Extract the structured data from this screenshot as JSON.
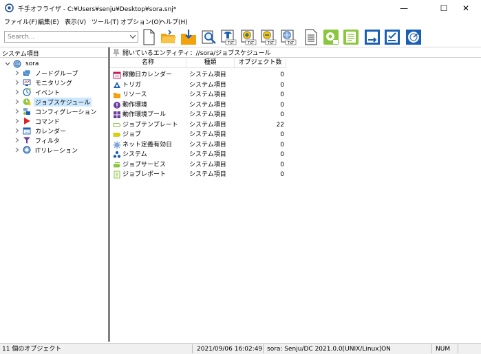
{
  "window": {
    "title": "千手オフライザ - C:¥Users¥senju¥Desktop¥sora.snj*",
    "minimize_glyph": "—",
    "maximize_glyph": "☐",
    "close_glyph": "✕"
  },
  "menu": {
    "items": [
      "ファイル(F)",
      "編集(E)",
      "表示(V)",
      "ツール(T)",
      "オプション(O)",
      "ヘルプ(H)"
    ]
  },
  "toolbar": {
    "search_placeholder": "Search...",
    "txt_label": "TXT"
  },
  "tree": {
    "header": "システム項目",
    "root_label": "sora",
    "items": [
      {
        "label": "ノードグループ",
        "icon": "node-group-icon"
      },
      {
        "label": "モニタリング",
        "icon": "monitoring-icon"
      },
      {
        "label": "イベント",
        "icon": "event-icon"
      },
      {
        "label": "ジョブスケジュール",
        "icon": "job-schedule-icon",
        "selected": true
      },
      {
        "label": "コンフィグレーション",
        "icon": "configuration-icon"
      },
      {
        "label": "コマンド",
        "icon": "command-icon"
      },
      {
        "label": "カレンダー",
        "icon": "calendar-icon"
      },
      {
        "label": "フィルタ",
        "icon": "filter-icon"
      },
      {
        "label": "ITリレーション",
        "icon": "it-relation-icon"
      }
    ]
  },
  "entity": {
    "label": "開いているエンティティ：//sora/ジョブスケジュール"
  },
  "table": {
    "columns": [
      "名称",
      "種類",
      "オブジェクト数"
    ],
    "rows": [
      {
        "name": "稼働日カレンダー",
        "type": "システム項目",
        "count": "0",
        "icon": "working-calendar-icon"
      },
      {
        "name": "トリガ",
        "type": "システム項目",
        "count": "0",
        "icon": "trigger-icon"
      },
      {
        "name": "リソース",
        "type": "システム項目",
        "count": "0",
        "icon": "resource-icon"
      },
      {
        "name": "動作環境",
        "type": "システム項目",
        "count": "0",
        "icon": "environment-icon"
      },
      {
        "name": "動作環境プール",
        "type": "システム項目",
        "count": "0",
        "icon": "environment-pool-icon"
      },
      {
        "name": "ジョブテンプレート",
        "type": "システム項目",
        "count": "22",
        "icon": "job-template-icon"
      },
      {
        "name": "ジョブ",
        "type": "システム項目",
        "count": "0",
        "icon": "job-icon"
      },
      {
        "name": "ネット定義有効日",
        "type": "システム項目",
        "count": "0",
        "icon": "net-valid-date-icon"
      },
      {
        "name": "システム",
        "type": "システム項目",
        "count": "0",
        "icon": "system-icon"
      },
      {
        "name": "ジョブサービス",
        "type": "システム項目",
        "count": "0",
        "icon": "job-service-icon"
      },
      {
        "name": "ジョブレポート",
        "type": "システム項目",
        "count": "0",
        "icon": "job-report-icon"
      }
    ]
  },
  "status": {
    "objects": "11 個のオブジェクト",
    "datetime": "2021/09/06 16:02:49",
    "server": "sora: Senju/DC 2021.0.0[UNIX/Linux]ON",
    "numlock": "NUM"
  },
  "colors": {
    "selection": "#cce8ff",
    "splitter": "#808080",
    "accent_blue": "#1a5fb4",
    "orange": "#f2a20c"
  }
}
